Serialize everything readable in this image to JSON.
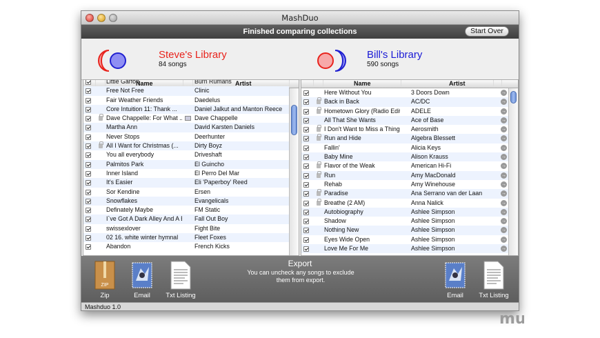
{
  "window": {
    "title": "MashDuo",
    "status": "Finished comparing collections",
    "start_over": "Start Over",
    "footer": "Mashduo 1.0"
  },
  "colors": {
    "steve": "#e8231c",
    "bill": "#1a1ad6"
  },
  "steve": {
    "name": "Steve's Library",
    "count": "84 songs"
  },
  "bill": {
    "name": "Bill's Library",
    "count": "590 songs"
  },
  "columns": {
    "name": "Name",
    "artist": "Artist"
  },
  "left_rows": [
    {
      "name": "Little Garfon",
      "artist": "Burn Rumans",
      "lock": false
    },
    {
      "name": "Free Not Free",
      "artist": "Clinic",
      "lock": false
    },
    {
      "name": "Fair Weather Friends",
      "artist": "Daedelus",
      "lock": false
    },
    {
      "name": "Core Intuition 11: Thank ...",
      "artist": "Daniel Jalkut and Manton Reece",
      "lock": false
    },
    {
      "name": "Dave Chappelle: For What ...",
      "artist": "Dave Chappelle",
      "lock": true,
      "disp": true
    },
    {
      "name": "Martha Ann",
      "artist": "David Karsten Daniels",
      "lock": false
    },
    {
      "name": "Never Stops",
      "artist": "Deerhunter",
      "lock": false
    },
    {
      "name": "All I Want for Christmas (...",
      "artist": "Dirty Boyz",
      "lock": true
    },
    {
      "name": "You all everybody",
      "artist": "Driveshaft",
      "lock": false
    },
    {
      "name": "Palmitos Park",
      "artist": "El Guincho",
      "lock": false
    },
    {
      "name": "Inner Island",
      "artist": "El Perro Del Mar",
      "lock": false
    },
    {
      "name": "It's Easier",
      "artist": "Eli 'Paperboy' Reed",
      "lock": false
    },
    {
      "name": "Sor Kendine",
      "artist": "Ersen",
      "lock": false
    },
    {
      "name": "Snowflakes",
      "artist": "Evangelicals",
      "lock": false
    },
    {
      "name": "Definately Maybe",
      "artist": "FM Static",
      "lock": false
    },
    {
      "name": "I`ve Got A Dark Alley And A B",
      "artist": "Fall Out Boy",
      "lock": false
    },
    {
      "name": "swissexlover",
      "artist": "Fight Bite",
      "lock": false
    },
    {
      "name": "02 16. white winter hymnal",
      "artist": "Fleet Foxes",
      "lock": false
    },
    {
      "name": "Abandon",
      "artist": "French Kicks",
      "lock": false
    }
  ],
  "right_rows": [
    {
      "name": "Here Without You",
      "artist": "3 Doors Down",
      "lock": false
    },
    {
      "name": "Back in Back",
      "artist": "AC/DC",
      "lock": true
    },
    {
      "name": "Hometown Glory (Radio Edit)",
      "artist": "ADELE",
      "lock": true
    },
    {
      "name": "All That She Wants",
      "artist": "Ace of Base",
      "lock": false
    },
    {
      "name": "I Don't Want to Miss a Thing",
      "artist": "Aerosmith",
      "lock": true
    },
    {
      "name": "Run and Hide",
      "artist": "Algebra Blessett",
      "lock": true
    },
    {
      "name": "Fallin'",
      "artist": "Alicia Keys",
      "lock": false
    },
    {
      "name": "Baby Mine",
      "artist": "Alison Krauss",
      "lock": false
    },
    {
      "name": "Flavor of the Weak",
      "artist": "American Hi-Fi",
      "lock": true
    },
    {
      "name": "Run",
      "artist": "Amy MacDonald",
      "lock": true
    },
    {
      "name": "Rehab",
      "artist": "Amy Winehouse",
      "lock": false
    },
    {
      "name": "Paradise",
      "artist": "Ana Serrano van der Laan",
      "lock": true
    },
    {
      "name": "Breathe (2 AM)",
      "artist": "Anna Nalick",
      "lock": true
    },
    {
      "name": "Autobiography",
      "artist": "Ashlee Simpson",
      "lock": false
    },
    {
      "name": "Shadow",
      "artist": "Ashlee Simpson",
      "lock": false
    },
    {
      "name": "Nothing New",
      "artist": "Ashlee Simpson",
      "lock": false
    },
    {
      "name": "Eyes Wide Open",
      "artist": "Ashlee Simpson",
      "lock": false
    },
    {
      "name": "Love Me For Me",
      "artist": "Ashlee Simpson",
      "lock": false
    }
  ],
  "export": {
    "title": "Export",
    "note": "You can uncheck any songs to exclude them from export.",
    "zip_badge": "ZIP",
    "left": {
      "zip": "Zip",
      "email": "Email",
      "txt": "Txt Listing"
    },
    "right": {
      "email": "Email",
      "txt": "Txt Listing"
    }
  },
  "watermark": "mu"
}
